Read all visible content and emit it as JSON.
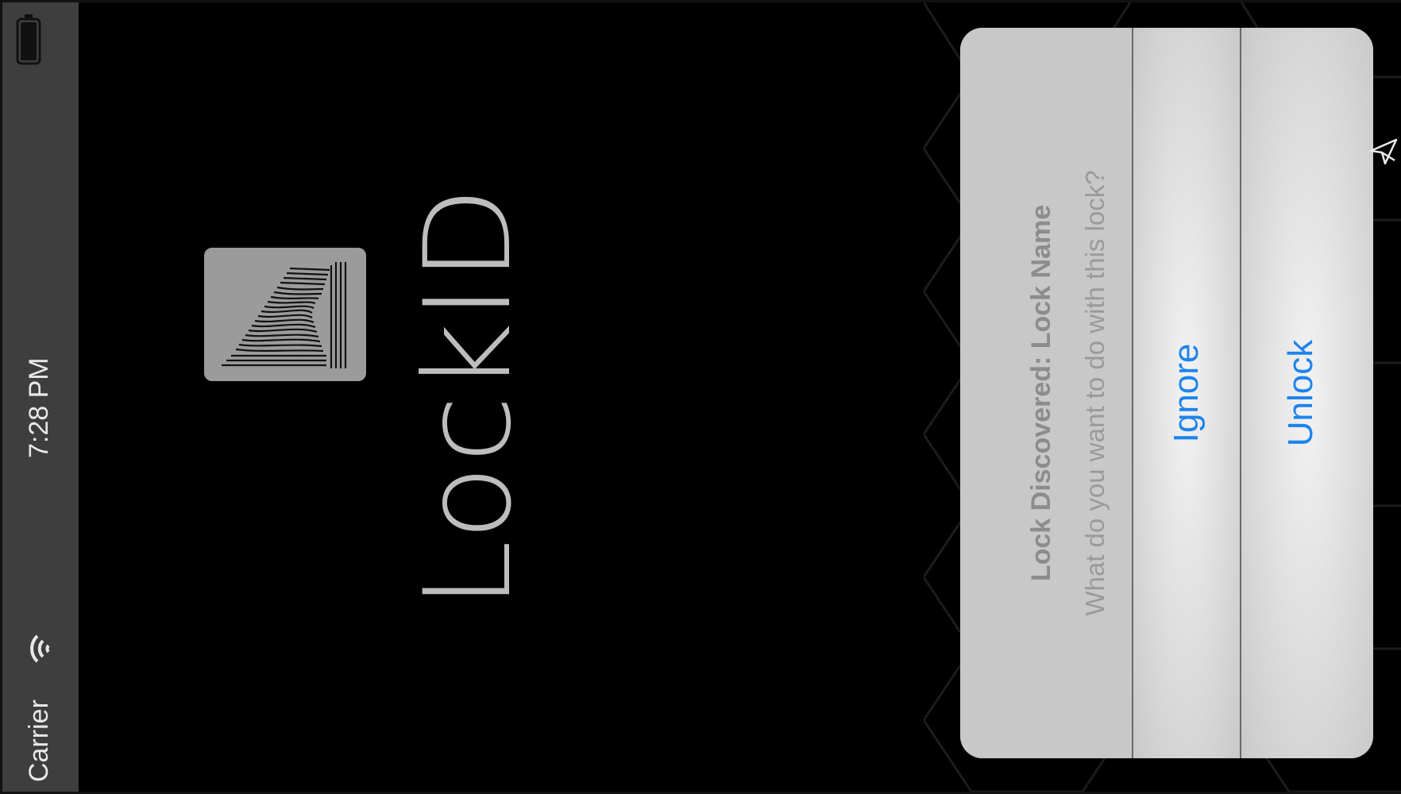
{
  "status_bar": {
    "carrier": "Carrier",
    "time": "7:28 PM",
    "wifi_icon": "wifi-icon",
    "battery_icon": "battery-icon"
  },
  "app": {
    "title": "LockID",
    "logo_icon": "fingerprint-l-logo"
  },
  "alert": {
    "title": "Lock Discovered: Lock Name",
    "message": "What do you want to do with this lock?",
    "buttons": {
      "ignore": "Ignore",
      "unlock": "Unlock"
    },
    "button_color": "#1e84ec"
  },
  "colors": {
    "background": "#000000",
    "status_bar": "#3e3e3e",
    "alert_background": "#cbcbcb",
    "logo_tile": "#9b9b9b"
  },
  "cursor": "mouse-pointer-icon"
}
